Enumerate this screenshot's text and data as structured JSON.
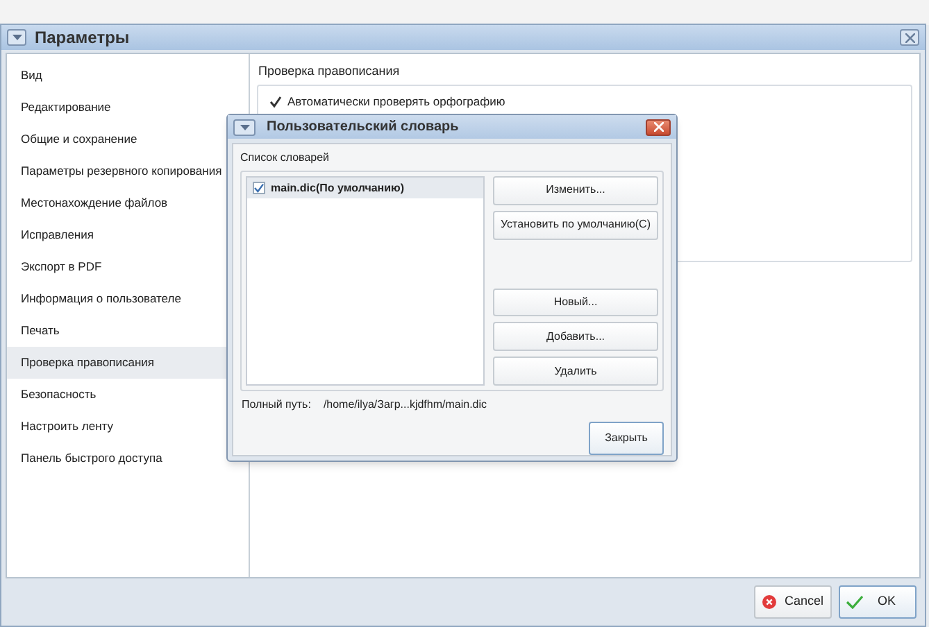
{
  "window": {
    "title": "Параметры"
  },
  "sidebar": {
    "items": [
      {
        "label": "Вид",
        "selected": false
      },
      {
        "label": "Редактирование",
        "selected": false
      },
      {
        "label": "Общие и сохранение",
        "selected": false
      },
      {
        "label": "Параметры резервного копирования",
        "selected": false
      },
      {
        "label": "Местонахождение файлов",
        "selected": false
      },
      {
        "label": "Исправления",
        "selected": false
      },
      {
        "label": "Экспорт в PDF",
        "selected": false
      },
      {
        "label": "Информация о пользователе",
        "selected": false
      },
      {
        "label": "Печать",
        "selected": false
      },
      {
        "label": "Проверка правописания",
        "selected": true
      },
      {
        "label": "Безопасность",
        "selected": false
      },
      {
        "label": "Настроить ленту",
        "selected": false
      },
      {
        "label": "Панель быстрого доступа",
        "selected": false
      }
    ]
  },
  "panel": {
    "heading": "Проверка правописания",
    "options": [
      {
        "label": "Автоматически проверять орфографию",
        "checked": true
      }
    ]
  },
  "dialog": {
    "title": "Пользовательский словарь",
    "list_label": "Список словарей",
    "dictionaries": [
      {
        "label": "main.dic(По умолчанию)",
        "checked": true,
        "selected": true
      }
    ],
    "buttons": [
      "Изменить...",
      "Установить по умолчанию(С)",
      "Новый...",
      "Добавить...",
      "Удалить"
    ],
    "path_label": "Полный путь:",
    "path": "/home/ilya/Загр...kjdfhm/main.dic",
    "close_button": "Закрыть"
  },
  "footer": {
    "cancel": "Cancel",
    "ok": "OK"
  }
}
